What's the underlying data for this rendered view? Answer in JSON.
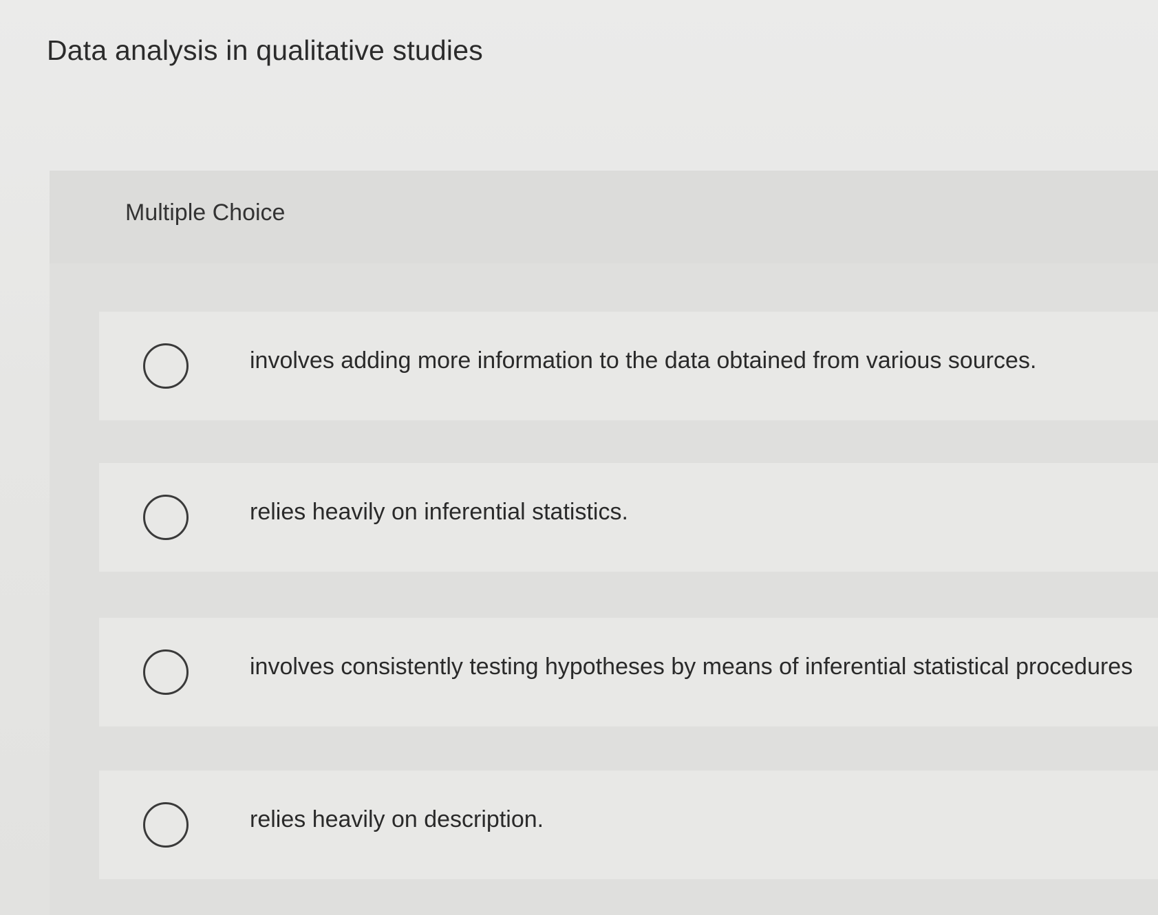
{
  "question": {
    "stem": "Data analysis in qualitative studies",
    "type_label": "Multiple Choice"
  },
  "choices": [
    {
      "label": "involves adding more information to the data obtained from various sources.",
      "selected": false
    },
    {
      "label": "relies heavily on inferential statistics.",
      "selected": false
    },
    {
      "label": "involves consistently testing hypotheses by means of inferential statistical procedures",
      "selected": false
    },
    {
      "label": "relies heavily on description.",
      "selected": false
    }
  ]
}
